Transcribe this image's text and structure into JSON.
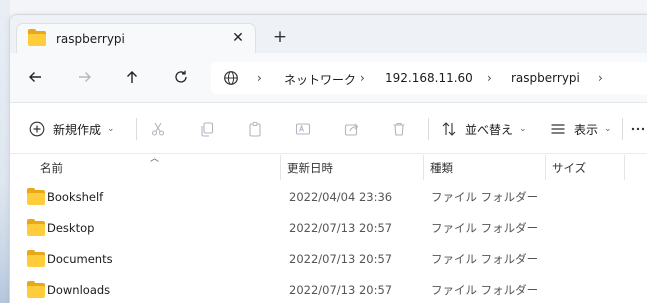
{
  "tab": {
    "title": "raspberrypi",
    "close": "✕",
    "new": "+"
  },
  "address": {
    "crumbs": [
      "ネットワーク",
      "192.168.11.60",
      "raspberrypi"
    ],
    "separator": "›"
  },
  "commands": {
    "new": "新規作成",
    "sort": "並べ替え",
    "view": "表示"
  },
  "columns": {
    "name": "名前",
    "modified": "更新日時",
    "type": "種類",
    "size": "サイズ"
  },
  "files": [
    {
      "name": "Bookshelf",
      "modified": "2022/04/04 23:36",
      "type": "ファイル フォルダー"
    },
    {
      "name": "Desktop",
      "modified": "2022/07/13 20:57",
      "type": "ファイル フォルダー"
    },
    {
      "name": "Documents",
      "modified": "2022/07/13 20:57",
      "type": "ファイル フォルダー"
    },
    {
      "name": "Downloads",
      "modified": "2022/07/13 20:57",
      "type": "ファイル フォルダー"
    }
  ],
  "colors": {
    "folder_back": "#e8a817",
    "folder_front": "#ffcd3c",
    "window_bg": "#ffffff"
  }
}
